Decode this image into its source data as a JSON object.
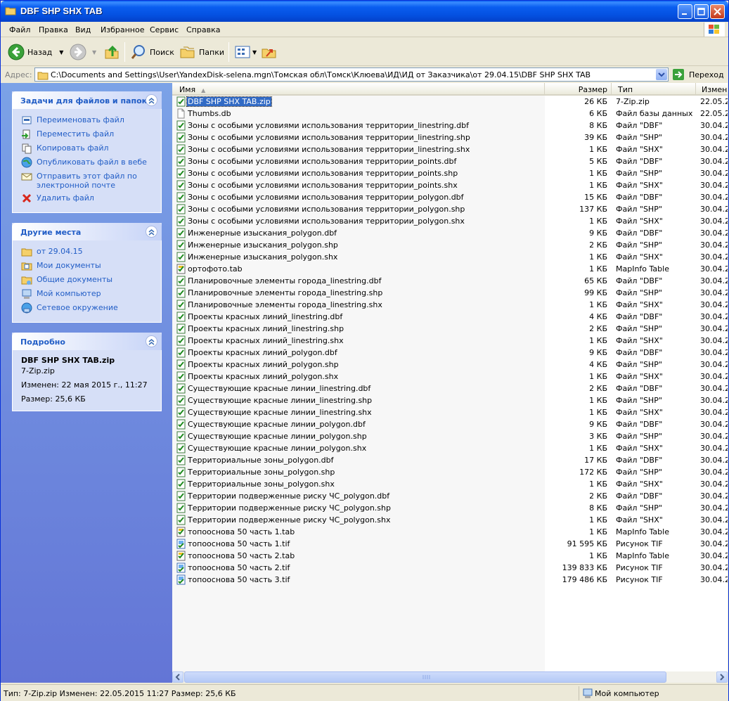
{
  "window": {
    "title": "DBF SHP SHX TAB"
  },
  "menu": [
    "Файл",
    "Правка",
    "Вид",
    "Избранное",
    "Сервис",
    "Справка"
  ],
  "toolbar": {
    "back": "Назад",
    "search": "Поиск",
    "folders": "Папки"
  },
  "address": {
    "label": "Адрес:",
    "path": "C:\\Documents and Settings\\User\\YandexDisk-selena.mgn\\Томская обл\\Томск\\Клюева\\ИД\\ИД от Заказчика\\от 29.04.15\\DBF SHP SHX TAB",
    "go": "Переход"
  },
  "tasks": {
    "title": "Задачи для файлов и папок",
    "items": [
      "Переименовать файл",
      "Переместить файл",
      "Копировать файл",
      "Опубликовать файл в вебе",
      "Отправить этот файл по электронной почте",
      "Удалить файл"
    ]
  },
  "places": {
    "title": "Другие места",
    "items": [
      "от 29.04.15",
      "Мои документы",
      "Общие документы",
      "Мой компьютер",
      "Сетевое окружение"
    ]
  },
  "details": {
    "title": "Подробно",
    "name": "DBF SHP SHX TAB.zip",
    "type": "7-Zip.zip",
    "modified": "Изменен: 22 мая 2015 г., 11:27",
    "size": "Размер: 25,6 КБ"
  },
  "columns": {
    "name": "Имя",
    "size": "Размер",
    "type": "Тип",
    "date": "Измене"
  },
  "files": [
    {
      "name": "DBF SHP SHX TAB.zip",
      "size": "26 КБ",
      "type": "7-Zip.zip",
      "date": "22.05.2",
      "icon": "zip"
    },
    {
      "name": "Thumbs.db",
      "size": "6 КБ",
      "type": "Файл базы данных",
      "date": "22.05.2",
      "icon": "doc"
    },
    {
      "name": "Зоны с особыми условиями использования территории_linestring.dbf",
      "size": "8 КБ",
      "type": "Файл \"DBF\"",
      "date": "30.04.2",
      "icon": "gis"
    },
    {
      "name": "Зоны с особыми условиями использования территории_linestring.shp",
      "size": "39 КБ",
      "type": "Файл \"SHP\"",
      "date": "30.04.2",
      "icon": "gis"
    },
    {
      "name": "Зоны с особыми условиями использования территории_linestring.shx",
      "size": "1 КБ",
      "type": "Файл \"SHX\"",
      "date": "30.04.2",
      "icon": "gis"
    },
    {
      "name": "Зоны с особыми условиями использования территории_points.dbf",
      "size": "5 КБ",
      "type": "Файл \"DBF\"",
      "date": "30.04.2",
      "icon": "gis"
    },
    {
      "name": "Зоны с особыми условиями использования территории_points.shp",
      "size": "1 КБ",
      "type": "Файл \"SHP\"",
      "date": "30.04.2",
      "icon": "gis"
    },
    {
      "name": "Зоны с особыми условиями использования территории_points.shx",
      "size": "1 КБ",
      "type": "Файл \"SHX\"",
      "date": "30.04.2",
      "icon": "gis"
    },
    {
      "name": "Зоны с особыми условиями использования территории_polygon.dbf",
      "size": "15 КБ",
      "type": "Файл \"DBF\"",
      "date": "30.04.2",
      "icon": "gis"
    },
    {
      "name": "Зоны с особыми условиями использования территории_polygon.shp",
      "size": "137 КБ",
      "type": "Файл \"SHP\"",
      "date": "30.04.2",
      "icon": "gis"
    },
    {
      "name": "Зоны с особыми условиями использования территории_polygon.shx",
      "size": "1 КБ",
      "type": "Файл \"SHX\"",
      "date": "30.04.2",
      "icon": "gis"
    },
    {
      "name": "Инженерные изыскания_polygon.dbf",
      "size": "9 КБ",
      "type": "Файл \"DBF\"",
      "date": "30.04.2",
      "icon": "gis"
    },
    {
      "name": "Инженерные изыскания_polygon.shp",
      "size": "2 КБ",
      "type": "Файл \"SHP\"",
      "date": "30.04.2",
      "icon": "gis"
    },
    {
      "name": "Инженерные изыскания_polygon.shx",
      "size": "1 КБ",
      "type": "Файл \"SHX\"",
      "date": "30.04.2",
      "icon": "gis"
    },
    {
      "name": "ортофото.tab",
      "size": "1 КБ",
      "type": "MapInfo Table",
      "date": "30.04.2",
      "icon": "tab"
    },
    {
      "name": "Планировочные элементы города_linestring.dbf",
      "size": "65 КБ",
      "type": "Файл \"DBF\"",
      "date": "30.04.2",
      "icon": "gis"
    },
    {
      "name": "Планировочные элементы города_linestring.shp",
      "size": "99 КБ",
      "type": "Файл \"SHP\"",
      "date": "30.04.2",
      "icon": "gis"
    },
    {
      "name": "Планировочные элементы города_linestring.shx",
      "size": "1 КБ",
      "type": "Файл \"SHX\"",
      "date": "30.04.2",
      "icon": "gis"
    },
    {
      "name": "Проекты красных линий_linestring.dbf",
      "size": "4 КБ",
      "type": "Файл \"DBF\"",
      "date": "30.04.2",
      "icon": "gis"
    },
    {
      "name": "Проекты красных линий_linestring.shp",
      "size": "2 КБ",
      "type": "Файл \"SHP\"",
      "date": "30.04.2",
      "icon": "gis"
    },
    {
      "name": "Проекты красных линий_linestring.shx",
      "size": "1 КБ",
      "type": "Файл \"SHX\"",
      "date": "30.04.2",
      "icon": "gis"
    },
    {
      "name": "Проекты красных линий_polygon.dbf",
      "size": "9 КБ",
      "type": "Файл \"DBF\"",
      "date": "30.04.2",
      "icon": "gis"
    },
    {
      "name": "Проекты красных линий_polygon.shp",
      "size": "4 КБ",
      "type": "Файл \"SHP\"",
      "date": "30.04.2",
      "icon": "gis"
    },
    {
      "name": "Проекты красных линий_polygon.shx",
      "size": "1 КБ",
      "type": "Файл \"SHX\"",
      "date": "30.04.2",
      "icon": "gis"
    },
    {
      "name": "Существующие красные линии_linestring.dbf",
      "size": "2 КБ",
      "type": "Файл \"DBF\"",
      "date": "30.04.2",
      "icon": "gis"
    },
    {
      "name": "Существующие красные линии_linestring.shp",
      "size": "1 КБ",
      "type": "Файл \"SHP\"",
      "date": "30.04.2",
      "icon": "gis"
    },
    {
      "name": "Существующие красные линии_linestring.shx",
      "size": "1 КБ",
      "type": "Файл \"SHX\"",
      "date": "30.04.2",
      "icon": "gis"
    },
    {
      "name": "Существующие красные линии_polygon.dbf",
      "size": "9 КБ",
      "type": "Файл \"DBF\"",
      "date": "30.04.2",
      "icon": "gis"
    },
    {
      "name": "Существующие красные линии_polygon.shp",
      "size": "3 КБ",
      "type": "Файл \"SHP\"",
      "date": "30.04.2",
      "icon": "gis"
    },
    {
      "name": "Существующие красные линии_polygon.shx",
      "size": "1 КБ",
      "type": "Файл \"SHX\"",
      "date": "30.04.2",
      "icon": "gis"
    },
    {
      "name": "Территориальные зоны_polygon.dbf",
      "size": "17 КБ",
      "type": "Файл \"DBF\"",
      "date": "30.04.2",
      "icon": "gis"
    },
    {
      "name": "Территориальные зоны_polygon.shp",
      "size": "172 КБ",
      "type": "Файл \"SHP\"",
      "date": "30.04.2",
      "icon": "gis"
    },
    {
      "name": "Территориальные зоны_polygon.shx",
      "size": "1 КБ",
      "type": "Файл \"SHX\"",
      "date": "30.04.2",
      "icon": "gis"
    },
    {
      "name": "Территории подверженные риску ЧС_polygon.dbf",
      "size": "2 КБ",
      "type": "Файл \"DBF\"",
      "date": "30.04.2",
      "icon": "gis"
    },
    {
      "name": "Территории подверженные риску ЧС_polygon.shp",
      "size": "8 КБ",
      "type": "Файл \"SHP\"",
      "date": "30.04.2",
      "icon": "gis"
    },
    {
      "name": "Территории подверженные риску ЧС_polygon.shx",
      "size": "1 КБ",
      "type": "Файл \"SHX\"",
      "date": "30.04.2",
      "icon": "gis"
    },
    {
      "name": "топооснова 50 часть 1.tab",
      "size": "1 КБ",
      "type": "MapInfo Table",
      "date": "30.04.2",
      "icon": "tab"
    },
    {
      "name": "топооснова 50 часть 1.tif",
      "size": "91 595 КБ",
      "type": "Рисунок TIF",
      "date": "30.04.2",
      "icon": "tif"
    },
    {
      "name": "топооснова 50 часть 2.tab",
      "size": "1 КБ",
      "type": "MapInfo Table",
      "date": "30.04.2",
      "icon": "tab"
    },
    {
      "name": "топооснова 50 часть 2.tif",
      "size": "139 833 КБ",
      "type": "Рисунок TIF",
      "date": "30.04.2",
      "icon": "tif"
    },
    {
      "name": "топооснова 50 часть 3.tif",
      "size": "179 486 КБ",
      "type": "Рисунок TIF",
      "date": "30.04.2",
      "icon": "tif"
    }
  ],
  "status": {
    "text": "Тип: 7-Zip.zip Изменен: 22.05.2015 11:27 Размер: 25,6 КБ",
    "zone": "Мой компьютер"
  },
  "colors": {
    "xp_blue": "#0054e3",
    "link": "#215dc6",
    "selection": "#316ac5"
  }
}
